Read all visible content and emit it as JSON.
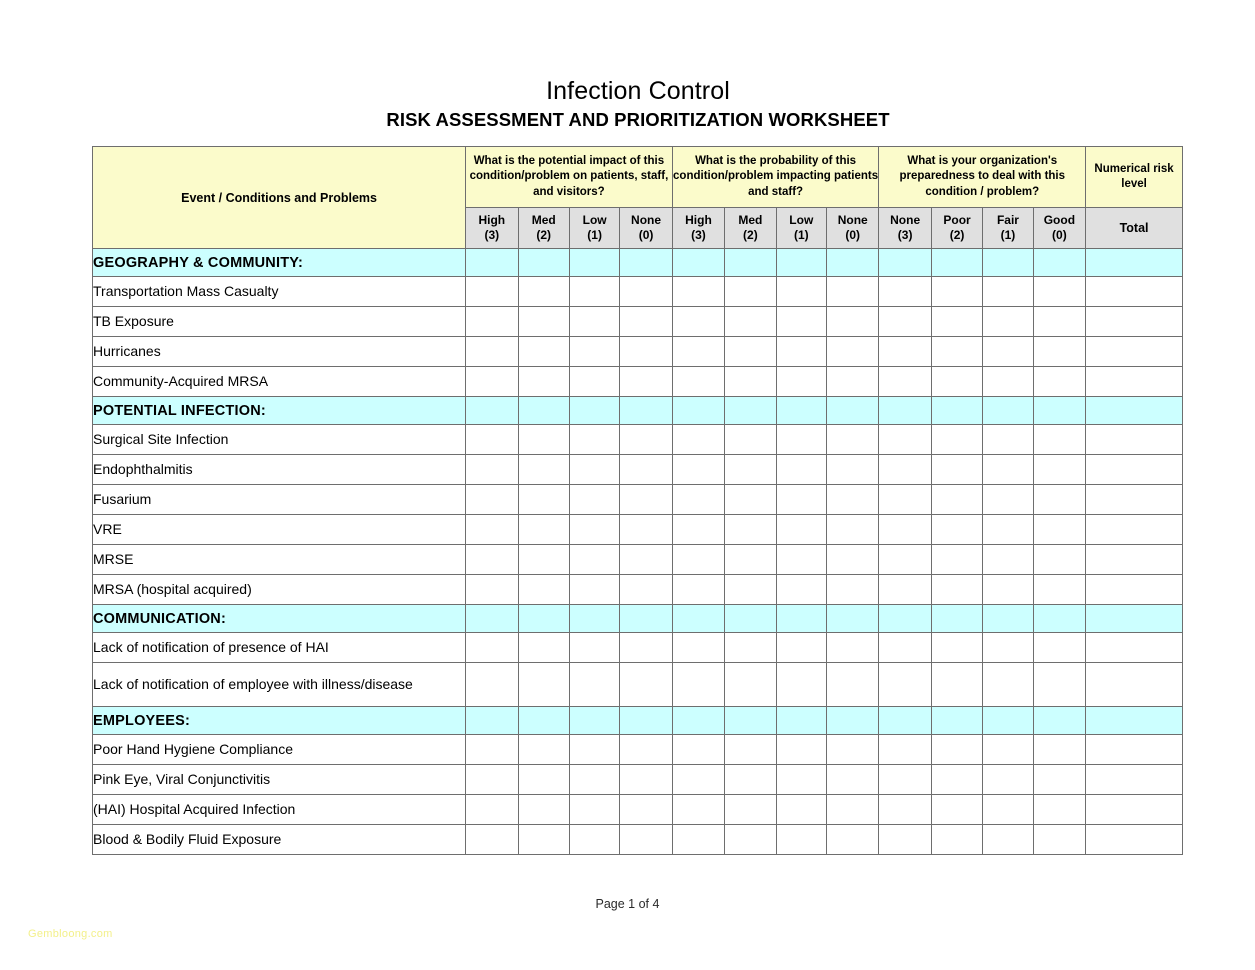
{
  "document": {
    "title_main": "Infection Control",
    "title_sub": "RISK ASSESSMENT AND PRIORITIZATION WORKSHEET",
    "footer_page": "Page 1 of 4",
    "watermark": "Gembloong.com"
  },
  "colors": {
    "header_yellow": "#FBFBCB",
    "subheader_gray": "#E0E0E0",
    "section_cyan": "#CCFFFF",
    "border_gray": "#6E6E6E",
    "watermark_yellow": "#F3F08A"
  },
  "table": {
    "group_headers": {
      "event": "Event / Conditions and Problems",
      "impact": "What is the potential impact of this condition/problem on patients, staff, and visitors?",
      "probability": "What is the probability of this condition/problem impacting patients and staff?",
      "preparedness": "What is your organization's preparedness to deal with this condition / problem?",
      "risk_level": "Numerical risk level"
    },
    "score_headers": {
      "impact": [
        {
          "label": "High",
          "score": "(3)"
        },
        {
          "label": "Med",
          "score": "(2)"
        },
        {
          "label": "Low",
          "score": "(1)"
        },
        {
          "label": "None",
          "score": "(0)"
        }
      ],
      "probability": [
        {
          "label": "High",
          "score": "(3)"
        },
        {
          "label": "Med",
          "score": "(2)"
        },
        {
          "label": "Low",
          "score": "(1)"
        },
        {
          "label": "None",
          "score": "(0)"
        }
      ],
      "preparedness": [
        {
          "label": "None",
          "score": "(3)"
        },
        {
          "label": "Poor",
          "score": "(2)"
        },
        {
          "label": "Fair",
          "score": "(1)"
        },
        {
          "label": "Good",
          "score": "(0)"
        }
      ],
      "total": "Total"
    },
    "sections": [
      {
        "name": "GEOGRAPHY & COMMUNITY:",
        "items": [
          {
            "label": "Transportation Mass Casualty",
            "tall": false
          },
          {
            "label": "TB Exposure",
            "tall": false
          },
          {
            "label": "Hurricanes",
            "tall": false
          },
          {
            "label": "Community-Acquired MRSA",
            "tall": false
          }
        ]
      },
      {
        "name": "POTENTIAL INFECTION:",
        "items": [
          {
            "label": "Surgical Site Infection",
            "tall": false
          },
          {
            "label": "Endophthalmitis",
            "tall": false
          },
          {
            "label": "Fusarium",
            "tall": false
          },
          {
            "label": "VRE",
            "tall": false
          },
          {
            "label": "MRSE",
            "tall": false
          },
          {
            "label": "MRSA (hospital acquired)",
            "tall": false
          }
        ]
      },
      {
        "name": "COMMUNICATION:",
        "items": [
          {
            "label": "Lack of notification of presence of HAI",
            "tall": false
          },
          {
            "label": "Lack of notification of employee with illness/disease",
            "tall": true
          }
        ]
      },
      {
        "name": "EMPLOYEES:",
        "items": [
          {
            "label": "Poor Hand Hygiene Compliance",
            "tall": false
          },
          {
            "label": "Pink Eye, Viral Conjunctivitis",
            "tall": false
          },
          {
            "label": "(HAI) Hospital Acquired Infection",
            "tall": false
          },
          {
            "label": "Blood & Bodily Fluid Exposure",
            "tall": false
          }
        ]
      }
    ]
  }
}
